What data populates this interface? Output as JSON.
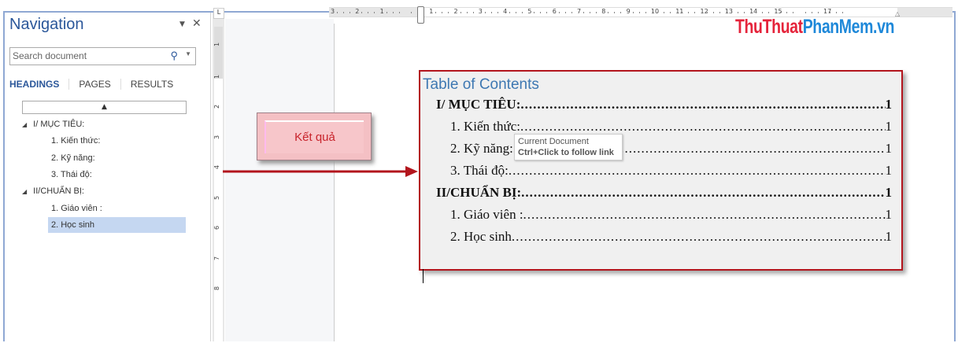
{
  "navigation": {
    "title": "Navigation",
    "search_placeholder": "Search document",
    "tabs": [
      "HEADINGS",
      "PAGES",
      "RESULTS"
    ],
    "items": [
      {
        "label": "I/ MỤC TIÊU:",
        "level": 1
      },
      {
        "label": "1. Kiến thức:",
        "level": 2
      },
      {
        "label": "2. Kỹ năng:",
        "level": 2
      },
      {
        "label": "3. Thái độ:",
        "level": 2
      },
      {
        "label": "II/CHUẨN BỊ:",
        "level": 1
      },
      {
        "label": "1. Giáo viên  :",
        "level": 2
      },
      {
        "label": "2. Học sinh",
        "level": 2,
        "selected": true
      }
    ]
  },
  "ruler": {
    "horizontal": [
      "3",
      "2",
      "1",
      "",
      "1",
      "2",
      "3",
      "4",
      "5",
      "6",
      "7",
      "8",
      "9",
      "10",
      "11",
      "12",
      "13",
      "14",
      "15",
      "",
      "17"
    ],
    "vertical": [
      "1",
      "1",
      "2",
      "3",
      "4",
      "5",
      "6",
      "7",
      "8"
    ]
  },
  "logo": {
    "part1": "ThuThuat",
    "part2": "PhanMem.vn"
  },
  "callout": {
    "label": "Kết quả"
  },
  "toc": {
    "heading": "Table of Contents",
    "entries": [
      {
        "label": "I/ MỤC TIÊU:",
        "page": "1",
        "bold": true
      },
      {
        "label": "1. Kiến thức:",
        "page": "1"
      },
      {
        "label": "2. Kỹ năng:",
        "page": "1"
      },
      {
        "label": "3. Thái độ:",
        "page": "1"
      },
      {
        "label": "II/CHUẨN BỊ:",
        "page": "1",
        "bold": true
      },
      {
        "label": "1.  Giáo viên  :",
        "page": "1"
      },
      {
        "label": "2.  Học sinh ",
        "page": "1"
      }
    ]
  },
  "tooltip": {
    "line1": "Current Document",
    "line2": "Ctrl+Click to follow link"
  },
  "colors": {
    "accent": "#2b579a",
    "toc_border": "#b3151d",
    "selection": "#c5d7f1"
  }
}
